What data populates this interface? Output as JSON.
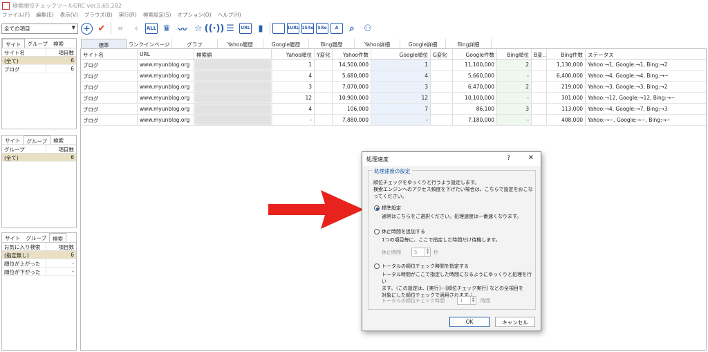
{
  "app": {
    "title": "検索順位チェックツールGRC  ver.5.65.282"
  },
  "menu": [
    "ファイル(F)",
    "編集(E)",
    "表示(V)",
    "ブラウズ(B)",
    "実行(R)",
    "検索設定(S)",
    "オプション(O)",
    "ヘルプ(H)"
  ],
  "filter": {
    "value": "全ての項目"
  },
  "toolbar": {
    "all_label": "ALL",
    "url_label": "URL",
    "url1_label": "1URL",
    "st1_label": "1Site",
    "st2_label": "Site",
    "ab_label": "A"
  },
  "site_panel": {
    "tabs": [
      "サイト",
      "グループ",
      "検索"
    ],
    "headers": [
      "サイト名",
      "項目数"
    ],
    "rows": [
      {
        "name": "(全て)",
        "count": "6"
      },
      {
        "name": "ブログ",
        "count": "6"
      }
    ]
  },
  "group_panel": {
    "tabs": [
      "サイト",
      "グループ",
      "検索"
    ],
    "headers": [
      "グループ",
      "項目数"
    ],
    "rows": [
      {
        "name": "(全て)",
        "count": "6"
      }
    ]
  },
  "search_panel": {
    "tabs": [
      "サイト",
      "グループ",
      "検索"
    ],
    "headers": [
      "お気に入り検索",
      "項目数"
    ],
    "rows": [
      {
        "name": "(指定無し)",
        "count": "6"
      },
      {
        "name": "順位が上がった",
        "count": "-"
      },
      {
        "name": "順位が下がった",
        "count": "-"
      }
    ]
  },
  "main_tabs": [
    "標準",
    "ランクインページ",
    "グラフ",
    "Yahoo履歴",
    "Google履歴",
    "Bing履歴",
    "Yahoo詳細",
    "Google詳細",
    "Bing詳細"
  ],
  "grid": {
    "headers": [
      "サイト名",
      "URL",
      "検索語",
      "Yahoo順位",
      "Y変化",
      "Yahoo件数",
      "Google順位",
      "G変化",
      "Google件数",
      "Bing順位",
      "B変...",
      "Bing件数",
      "ステータス"
    ],
    "rows": [
      [
        "ブログ",
        "www.myunblog.org",
        "",
        "1",
        "",
        "14,500,000",
        "1",
        "",
        "11,100,000",
        "2",
        "",
        "1,130,000",
        "Yahoo:→1, Google:→1, Bing:→2"
      ],
      [
        "ブログ",
        "www.myunblog.org",
        "",
        "4",
        "",
        "5,680,000",
        "4",
        "",
        "5,660,000",
        "-",
        "",
        "6,400,000",
        "Yahoo:→4, Google:→4, Bing:→−"
      ],
      [
        "ブログ",
        "www.myunblog.org",
        "",
        "3",
        "",
        "7,070,000",
        "3",
        "",
        "6,470,000",
        "2",
        "",
        "219,000",
        "Yahoo:→3, Google:→3, Bing:→2"
      ],
      [
        "ブログ",
        "www.myunblog.org",
        "",
        "12",
        "",
        "10,900,000",
        "12",
        "",
        "10,100,000",
        "-",
        "",
        "301,000",
        "Yahoo:→12, Google:→12, Bing:→−"
      ],
      [
        "ブログ",
        "www.myunblog.org",
        "",
        "4",
        "",
        "106,000",
        "7",
        "",
        "86,100",
        "3",
        "",
        "113,000",
        "Yahoo:→4, Google:→7, Bing:→3"
      ],
      [
        "ブログ",
        "www.myunblog.org",
        "",
        "-",
        "",
        "7,880,000",
        "-",
        "",
        "7,180,000",
        "-",
        "",
        "408,000",
        "Yahoo:→−, Google:→−, Bing:→−"
      ]
    ]
  },
  "dialog": {
    "title": "処理速度",
    "help": "?",
    "close": "✕",
    "group_label": "処理速度の設定",
    "intro": [
      "順位チェックをゆっくりと行うよう設定します。",
      "検索エンジンへのアクセス頻度を下げたい場合は、こちらで設定をおこな",
      "ってください。"
    ],
    "opt1_label": "標準設定",
    "opt1_desc": "通常はこちらをご選択ください。処理速度は一番速くなります。",
    "opt2_label": "休止時間を追加する",
    "opt2_desc": "1つの項目毎に、ここで指定した時間だけ待機します。",
    "pause_label": "休止時間",
    "pause_value": "5",
    "pause_unit": "秒",
    "opt3_label": "トータルの順位チェック時間を指定する",
    "opt3_desc": [
      "トータル時間がここで指定した時間になるようにゆっくりと処理を行い",
      "ます。（この設定は、[実行]－[順位チェック実行] などの全項目を",
      "対象にした順位チェックで適用されます。）"
    ],
    "total_label": "トータルの順位チェック時間",
    "total_value": "1",
    "total_unit": "時間",
    "ok": "OK",
    "cancel": "キャンセル"
  },
  "colors": {
    "accent": "#1d5aa8",
    "arrow": "#e8231d",
    "selected_row": "#e9e0c4"
  }
}
